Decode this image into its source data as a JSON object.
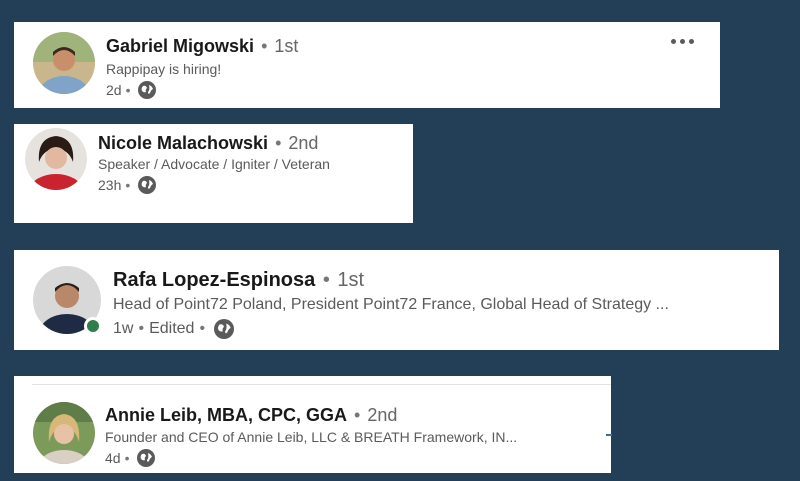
{
  "colors": {
    "background": "#233f57",
    "card": "#ffffff",
    "online": "#2e7d4a",
    "secondary_text": "#5a5a5a"
  },
  "posts": [
    {
      "name": "Gabriel Migowski",
      "separator": "•",
      "degree": "1st",
      "headline": "Rappipay is hiring!",
      "time": "2d",
      "meta_sep": "•",
      "edited": "",
      "visibility_icon": "globe-icon",
      "has_more_menu": true
    },
    {
      "name": "Nicole Malachowski",
      "separator": "•",
      "degree": "2nd",
      "headline": "Speaker / Advocate / Igniter / Veteran",
      "time": "23h",
      "meta_sep": "•",
      "edited": "",
      "visibility_icon": "globe-icon"
    },
    {
      "name": "Rafa Lopez-Espinosa",
      "separator": "•",
      "degree": "1st",
      "headline": "Head of Point72 Poland, President Point72 France, Global Head of Strategy ...",
      "time": "1w",
      "meta_sep": "•",
      "edited": "Edited",
      "visibility_icon": "globe-icon",
      "online": true
    },
    {
      "name": "Annie Leib, MBA, CPC, GGA",
      "separator": "•",
      "degree": "2nd",
      "headline": "Founder and CEO of Annie Leib, LLC & BREATH Framework, IN...",
      "time": "4d",
      "meta_sep": "•",
      "edited": "",
      "visibility_icon": "globe-icon"
    }
  ]
}
